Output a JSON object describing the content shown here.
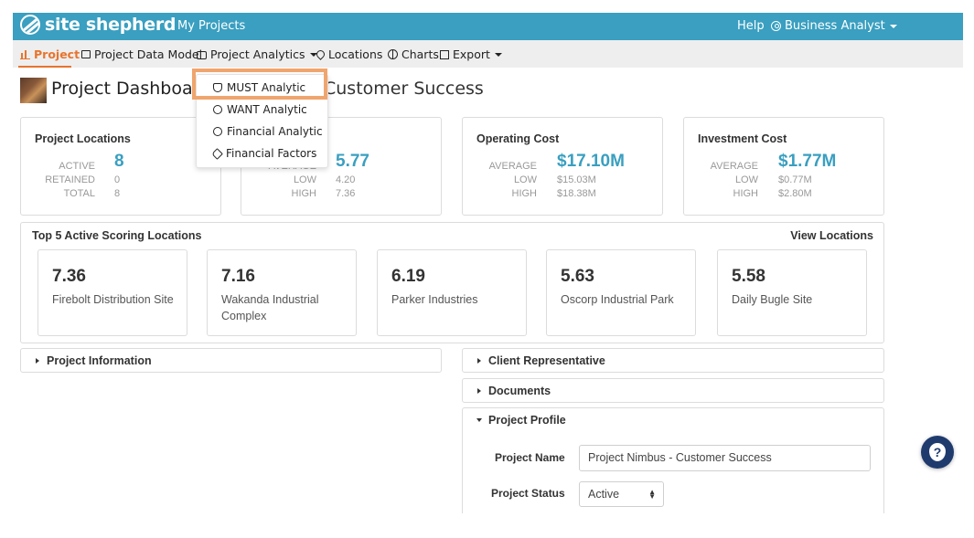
{
  "topbar": {
    "brand": "site shepherd",
    "my_projects": "My Projects",
    "help": "Help",
    "user_role": "Business Analyst",
    "bg_color": "#3a9fc0"
  },
  "nav": {
    "items": [
      {
        "label": "Project",
        "icon": "bar-chart-icon",
        "active": true
      },
      {
        "label": "Project Data Model",
        "icon": "tree-icon"
      },
      {
        "label": "Project Analytics",
        "icon": "briefcase-icon",
        "dropdown": true
      },
      {
        "label": "Locations",
        "icon": "map-pin-icon"
      },
      {
        "label": "Charts",
        "icon": "pie-chart-icon"
      },
      {
        "label": "Export",
        "icon": "external-link-icon",
        "dropdown": true
      }
    ],
    "active_color": "#e8742e"
  },
  "dropdown": {
    "items": [
      {
        "label": "MUST Analytic",
        "icon": "shield-check-icon",
        "highlighted": true
      },
      {
        "label": "WANT Analytic",
        "icon": "gauge-icon"
      },
      {
        "label": "Financial Analytic",
        "icon": "dollar-circle-icon"
      },
      {
        "label": "Financial Factors",
        "icon": "tag-icon"
      }
    ]
  },
  "page": {
    "title": "Project Dashboard",
    "subtitle_visible": "Customer Success"
  },
  "kpis": {
    "locations": {
      "title": "Project Locations",
      "active_label": "ACTIVE",
      "active": "8",
      "retained_label": "RETAINED",
      "retained": "0",
      "total_label": "TOTAL",
      "total": "8"
    },
    "score": {
      "average_label": "AVERAGE",
      "average": "5.77",
      "low_label": "LOW",
      "low": "4.20",
      "high_label": "HIGH",
      "high": "7.36"
    },
    "operating": {
      "title": "Operating Cost",
      "average_label": "AVERAGE",
      "average": "$17.10M",
      "low_label": "LOW",
      "low": "$15.03M",
      "high_label": "HIGH",
      "high": "$18.38M"
    },
    "investment": {
      "title": "Investment Cost",
      "average_label": "AVERAGE",
      "average": "$1.77M",
      "low_label": "LOW",
      "low": "$0.77M",
      "high_label": "HIGH",
      "high": "$2.80M"
    }
  },
  "top5": {
    "title": "Top 5 Active Scoring Locations",
    "view_link": "View Locations",
    "locations": [
      {
        "score": "7.36",
        "name": "Firebolt Distribution Site"
      },
      {
        "score": "7.16",
        "name": "Wakanda Industrial Complex"
      },
      {
        "score": "6.19",
        "name": "Parker Industries"
      },
      {
        "score": "5.63",
        "name": "Oscorp Industrial Park"
      },
      {
        "score": "5.58",
        "name": "Daily Bugle Site"
      }
    ]
  },
  "sections": {
    "project_info": "Project Information",
    "client_rep": "Client Representative",
    "documents": "Documents",
    "profile": "Project Profile"
  },
  "profile": {
    "name_label": "Project Name",
    "name_value": "Project Nimbus - Customer Success",
    "status_label": "Project Status",
    "status_value": "Active"
  },
  "help_fab": "?"
}
